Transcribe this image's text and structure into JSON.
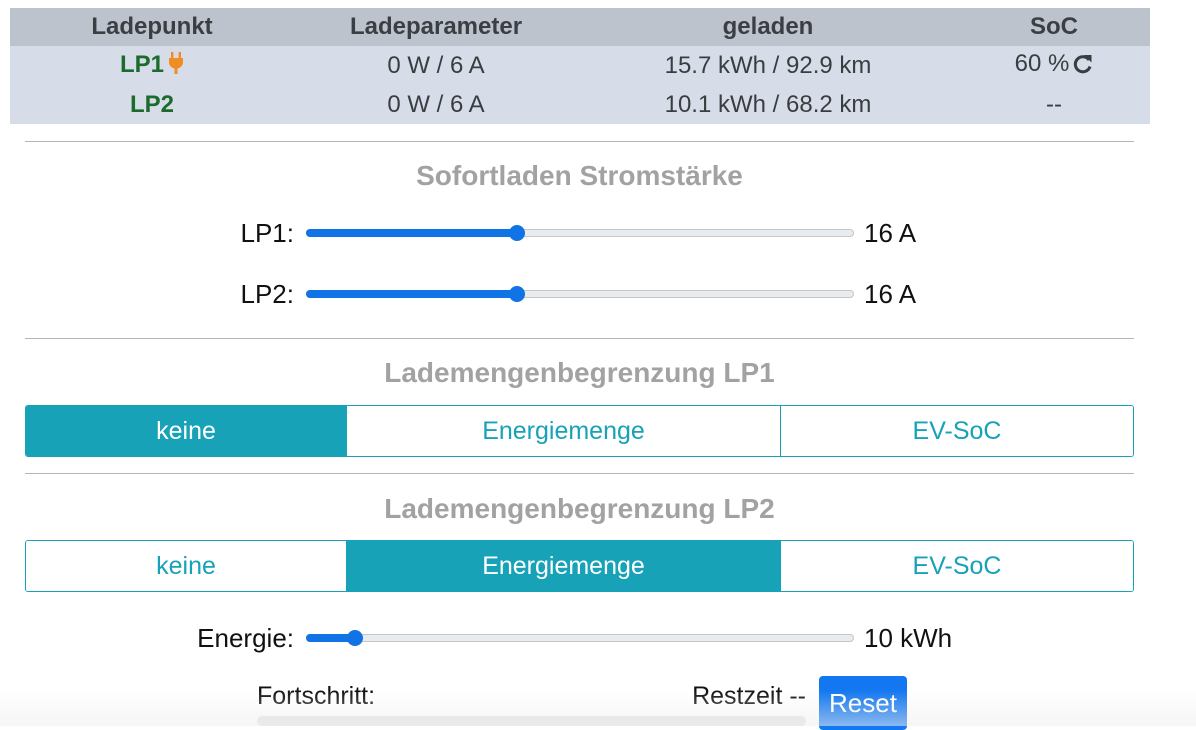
{
  "table": {
    "headers": [
      "Ladepunkt",
      "Ladeparameter",
      "geladen",
      "SoC"
    ],
    "rows": [
      {
        "name": "LP1",
        "params": "0 W / 6 A",
        "charged": "15.7 kWh / 92.9 km",
        "soc": "60 %"
      },
      {
        "name": "LP2",
        "params": "0 W / 6 A",
        "charged": "10.1 kWh / 68.2 km",
        "soc": "--"
      }
    ]
  },
  "sofortladen": {
    "title": "Sofortladen Stromstärke",
    "sliders": [
      {
        "label": "LP1:",
        "value": "16 A",
        "fraction": 0.385
      },
      {
        "label": "LP2:",
        "value": "16 A",
        "fraction": 0.385
      }
    ]
  },
  "limit_lp1": {
    "title": "Lademengenbegrenzung LP1",
    "options": [
      "keine",
      "Energiemenge",
      "EV-SoC"
    ],
    "selected": "keine"
  },
  "limit_lp2": {
    "title": "Lademengenbegrenzung LP2",
    "options": [
      "keine",
      "Energiemenge",
      "EV-SoC"
    ],
    "selected": "Energiemenge",
    "energy_slider": {
      "label": "Energie:",
      "value": "10 kWh",
      "fraction": 0.09
    },
    "progress_label": "Fortschritt:",
    "restzeit_label": "Restzeit --",
    "reset_label": "Reset",
    "progress": 0
  },
  "icons": {
    "plug": "plug-icon",
    "reload": "reload-icon"
  },
  "colors": {
    "accent": "#17a2b8",
    "slider": "#1073e6",
    "lp_name": "#1b6b2c",
    "plug": "#f08c24",
    "reset": "#1277f0"
  }
}
